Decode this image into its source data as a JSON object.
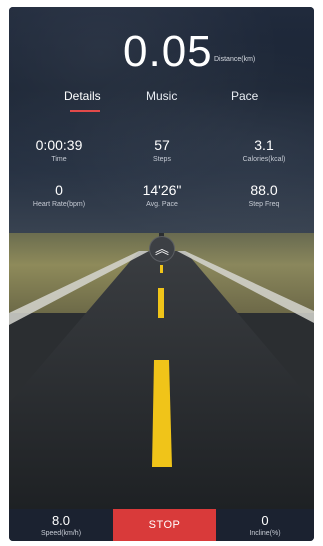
{
  "header": {
    "distance_value": "0.05",
    "distance_unit": "Distance(km)"
  },
  "tabs": [
    {
      "label": "Details",
      "active": true
    },
    {
      "label": "Music",
      "active": false
    },
    {
      "label": "Pace",
      "active": false
    }
  ],
  "stats": [
    {
      "value": "0:00:39",
      "label": "Time"
    },
    {
      "value": "57",
      "label": "Steps"
    },
    {
      "value": "3.1",
      "label": "Calories(kcal)"
    },
    {
      "value": "0",
      "label": "Heart Rate(bpm)"
    },
    {
      "value": "14'26\"",
      "label": "Avg. Pace"
    },
    {
      "value": "88.0",
      "label": "Step Freq"
    }
  ],
  "scene": {
    "expand_icon": "double-chevron-up-icon"
  },
  "bottom": {
    "speed_value": "8.0",
    "speed_label": "Speed(km/h)",
    "stop_label": "STOP",
    "incline_value": "0",
    "incline_label": "Incline(%)"
  },
  "colors": {
    "accent": "#e24a4a",
    "stop": "#d93a3a",
    "road_line": "#f0c419"
  }
}
